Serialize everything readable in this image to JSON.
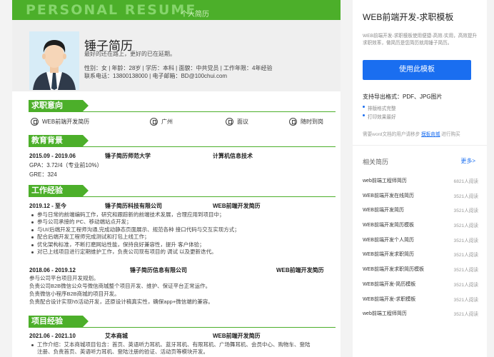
{
  "resume": {
    "banner_en": "PERSONAL RESUME",
    "banner_cn": "个人简历",
    "name": "锤子简历",
    "motto": "最好的还在路上，更好的已在延期。",
    "info_line1": "性别：女 | 年龄：28岁 | 学历：本科 | 面貌：中共党员 | 工作年限：4年经验",
    "info_line2": "联系电话：13800138000 | 电子邮箱：BD@100chui.com",
    "intent": {
      "title": "求职意向",
      "position": "WEB前端开发简历",
      "city": "广州",
      "salary": "面议",
      "arrival": "随时到岗"
    },
    "education": {
      "title": "教育背景",
      "period": "2015.09 - 2019.06",
      "school": "锤子简历师范大学",
      "major": "计算机信息技术",
      "gpa": "GPA：3.72/4（专业前10%）",
      "gre": "GRE：324"
    },
    "work": {
      "title": "工作经验",
      "job1": {
        "period": "2019.12 - 至今",
        "company": "锤子简历科技有限公司",
        "role": "WEB前端开发简历",
        "bullets": [
          "参与日常的前端编码工作，研究和跟踪新的前端技术发展，合理应用到项目中；",
          "参与公司承接的 PC、移动端站点开发；",
          "与UI/后端开发工程师沟通,完成动静态页面展示、规范各种 接口代码与交互实现方式；",
          "配合后端开发工程师完成测试和打包上线工作；",
          "优化架构标准，不断打磨网站性能，保持良好兼容性，提升 客户体验；",
          "对已上线项目进行定期维护工作，负责公司现有项目的 调试 以及更新迭代。"
        ]
      },
      "job2": {
        "period": "2018.06 - 2019.12",
        "company": "锤子简历信息有限公司",
        "role": "WEB前端开发简历",
        "lines": [
          "参与公司平台项目开发规划。",
          "负责公司B2B微信公众号微信商城整个项目开发、维护、保证平台正常运作。",
          "负责微信小程序B2B商城的项目开发。",
          "负责配合设计实现h5活动开发，还原设计稿真实性，确保app+微信端的兼容。"
        ]
      }
    },
    "project": {
      "title": "项目经验",
      "period": "2021.06 - 2021.10",
      "company": "艾本商城",
      "role": "WEB前端开发简历",
      "bullet1": "工作介绍：艾本商城项目包含：首页、英语听力耳机、蓝牙耳机、有限耳机、广场舞耳机、会员中心、购物车、登陆",
      "line2": "注册、负责首页、英语听力耳机、登陆注册的验证、活动页等模块开发。"
    }
  },
  "sidebar": {
    "title": "WEB前端开发-求职模板",
    "desc": "WEB前端开发-求职模板使用便捷-高效-实用，高效提升求职效率，做简历是您简历就用锤子简历。",
    "use_button": "使用此模板",
    "support": "支持导出格式：PDF、JPG图片",
    "features": [
      "排版格式完整",
      "打印效果最好"
    ],
    "need_prefix": "需要word文档的用户请移步",
    "need_link": "模板商城",
    "need_suffix": "进行购买",
    "related_title": "相关简历",
    "more": "更多>",
    "related": [
      {
        "name": "web前端工程师简历",
        "count": "6821人阅读"
      },
      {
        "name": "WEB前端开发在线简历",
        "count": "3521人阅读"
      },
      {
        "name": "WEB前端开发简历",
        "count": "3521人阅读"
      },
      {
        "name": "WEB前端开发简历模板",
        "count": "3521人阅读"
      },
      {
        "name": "WEB前端开发个人简历",
        "count": "3521人阅读"
      },
      {
        "name": "WEB前端开发求职简历",
        "count": "3521人阅读"
      },
      {
        "name": "WEB前端开发求职简历模板",
        "count": "3521人阅读"
      },
      {
        "name": "WEB前端开发-简历模板",
        "count": "3521人阅读"
      },
      {
        "name": "WEB前端开发-求职模板",
        "count": "3521人阅读"
      },
      {
        "name": "web前端工程师简历",
        "count": "3521人阅读"
      }
    ]
  }
}
